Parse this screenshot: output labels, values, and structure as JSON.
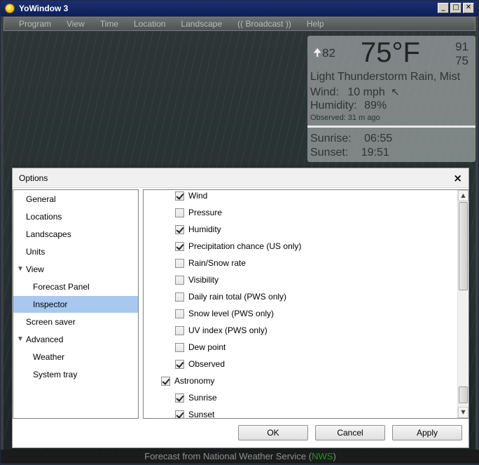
{
  "window": {
    "title": "YoWindow 3"
  },
  "menu": [
    "Program",
    "View",
    "Time",
    "Location",
    "Landscape",
    "(( Broadcast ))",
    "Help"
  ],
  "weather": {
    "feels_like": "82",
    "temperature": "75°F",
    "high": "91",
    "low": "75",
    "condition": "Light Thunderstorm Rain, Mist",
    "wind_label": "Wind:",
    "wind_value": "10 mph",
    "humidity_label": "Humidity:",
    "humidity_value": "89%",
    "observed": "Observed:  31 m ago",
    "sunrise_label": "Sunrise:",
    "sunrise_value": "06:55",
    "sunset_label": "Sunset:",
    "sunset_value": "19:51"
  },
  "status": {
    "prefix": "Forecast from National Weather Service (",
    "source": "NWS",
    "suffix": ")"
  },
  "dialog": {
    "title": "Options",
    "close": "×",
    "nav": [
      {
        "label": "General",
        "selected": false,
        "indent": 1,
        "expandable": false
      },
      {
        "label": "Locations",
        "selected": false,
        "indent": 1,
        "expandable": false
      },
      {
        "label": "Landscapes",
        "selected": false,
        "indent": 1,
        "expandable": false
      },
      {
        "label": "Units",
        "selected": false,
        "indent": 1,
        "expandable": false
      },
      {
        "label": "View",
        "selected": false,
        "indent": 1,
        "expandable": true
      },
      {
        "label": "Forecast Panel",
        "selected": false,
        "indent": 2,
        "expandable": false
      },
      {
        "label": "Inspector",
        "selected": true,
        "indent": 2,
        "expandable": false
      },
      {
        "label": "Screen saver",
        "selected": false,
        "indent": 1,
        "expandable": false
      },
      {
        "label": "Advanced",
        "selected": false,
        "indent": 1,
        "expandable": true
      },
      {
        "label": "Weather",
        "selected": false,
        "indent": 2,
        "expandable": false
      },
      {
        "label": "System tray",
        "selected": false,
        "indent": 2,
        "expandable": false
      }
    ],
    "options": [
      {
        "label": "Wind",
        "checked": true,
        "level": 2
      },
      {
        "label": "Pressure",
        "checked": false,
        "level": 2
      },
      {
        "label": "Humidity",
        "checked": true,
        "level": 2
      },
      {
        "label": "Precipitation chance (US only)",
        "checked": true,
        "level": 2
      },
      {
        "label": "Rain/Snow rate",
        "checked": false,
        "level": 2
      },
      {
        "label": "Visibility",
        "checked": false,
        "level": 2
      },
      {
        "label": "Daily rain total (PWS only)",
        "checked": false,
        "level": 2
      },
      {
        "label": "Snow level (PWS only)",
        "checked": false,
        "level": 2
      },
      {
        "label": "UV index (PWS only)",
        "checked": false,
        "level": 2
      },
      {
        "label": "Dew point",
        "checked": false,
        "level": 2
      },
      {
        "label": "Observed",
        "checked": true,
        "level": 2
      },
      {
        "label": "Astronomy",
        "checked": true,
        "level": 1
      },
      {
        "label": "Sunrise",
        "checked": true,
        "level": 2
      },
      {
        "label": "Sunset",
        "checked": true,
        "level": 2
      }
    ],
    "buttons": {
      "ok": "OK",
      "cancel": "Cancel",
      "apply": "Apply"
    }
  }
}
